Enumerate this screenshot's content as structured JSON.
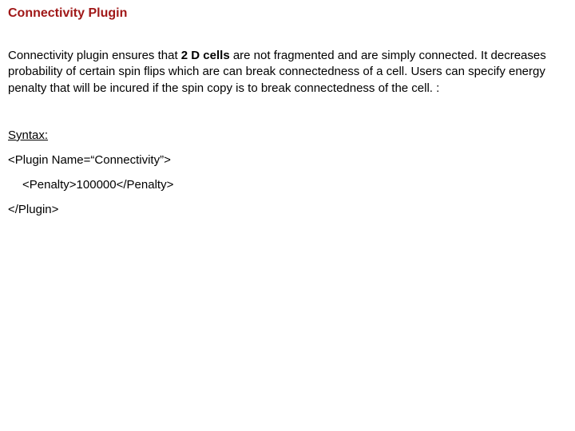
{
  "title": "Connectivity Plugin",
  "description": {
    "before_bold": "Connectivity plugin ensures that ",
    "bold": "2 D cells",
    "after_bold": " are not fragmented and are simply connected. It decreases probability of certain spin flips which are can break connectedness of a cell. Users can specify energy penalty that will be incured if the spin copy is to break connectedness of the cell. :"
  },
  "syntax_label": "Syntax:",
  "code": {
    "open_tag": "<Plugin Name=“Connectivity”>",
    "penalty_line": "<Penalty>100000</Penalty>",
    "close_tag": "</Plugin>"
  }
}
